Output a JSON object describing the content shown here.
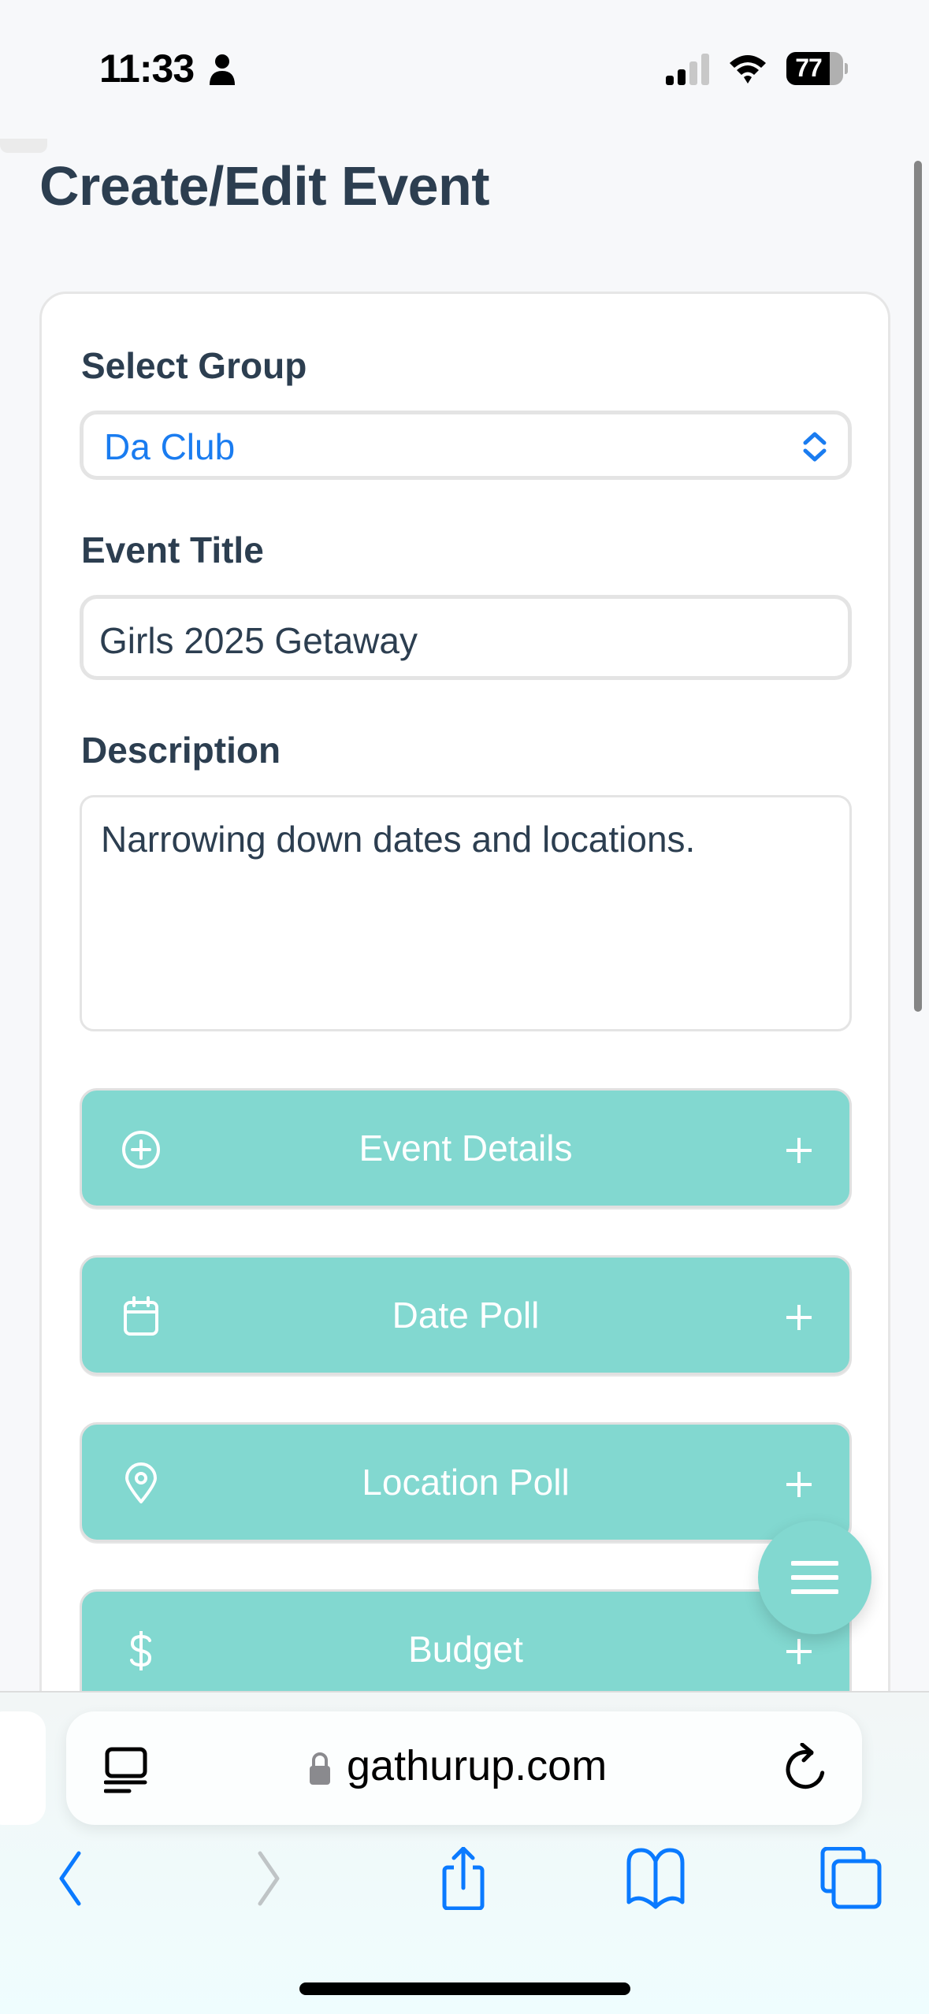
{
  "status_bar": {
    "time": "11:33",
    "battery_percent": 77,
    "battery_label": "77",
    "signal_bars_active": 2,
    "signal_bars_total": 4
  },
  "page": {
    "title": "Create/Edit Event"
  },
  "form": {
    "group": {
      "label": "Select Group",
      "value": "Da Club"
    },
    "event_title": {
      "label": "Event Title",
      "value": "Girls 2025 Getaway"
    },
    "description": {
      "label": "Description",
      "value": "Narrowing down dates and locations."
    },
    "sections": [
      {
        "label": "Event Details",
        "icon": "plus-circle-icon"
      },
      {
        "label": "Date Poll",
        "icon": "calendar-icon"
      },
      {
        "label": "Location Poll",
        "icon": "map-pin-icon"
      },
      {
        "label": "Budget",
        "icon": "dollar-icon"
      }
    ]
  },
  "fab": {
    "icon": "menu-icon"
  },
  "browser": {
    "url": "gathurup.com",
    "toolbar": [
      "back",
      "forward",
      "share",
      "bookmarks",
      "tabs"
    ]
  },
  "colors": {
    "accent_teal": "#82d8d0",
    "link_blue": "#1a7cf0",
    "heading": "#2c3e50",
    "safari_blue": "#0a7aff"
  }
}
